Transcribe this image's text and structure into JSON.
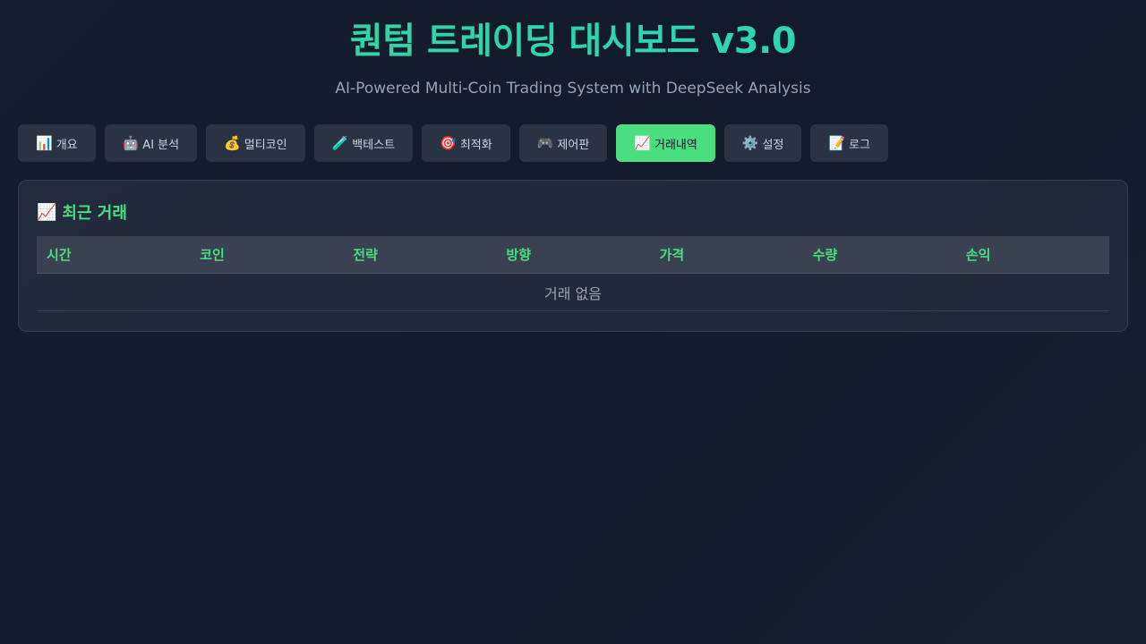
{
  "header": {
    "title": "퀀텀 트레이딩 대시보드 v3.0",
    "subtitle": "AI-Powered Multi-Coin Trading System with DeepSeek Analysis"
  },
  "tabs": [
    {
      "icon": "📊",
      "icon_name": "bar-chart-icon",
      "label": "개요",
      "active": false
    },
    {
      "icon": "🤖",
      "icon_name": "robot-icon",
      "label": "AI 분석",
      "active": false
    },
    {
      "icon": "💰",
      "icon_name": "money-bag-icon",
      "label": "멀티코인",
      "active": false
    },
    {
      "icon": "🧪",
      "icon_name": "test-tube-icon",
      "label": "백테스트",
      "active": false
    },
    {
      "icon": "🎯",
      "icon_name": "target-icon",
      "label": "최적화",
      "active": false
    },
    {
      "icon": "🎮",
      "icon_name": "gamepad-icon",
      "label": "제어판",
      "active": false
    },
    {
      "icon": "📈",
      "icon_name": "chart-up-icon",
      "label": "거래내역",
      "active": true
    },
    {
      "icon": "⚙️",
      "icon_name": "gear-icon",
      "label": "설정",
      "active": false
    },
    {
      "icon": "📝",
      "icon_name": "memo-icon",
      "label": "로그",
      "active": false
    }
  ],
  "panel": {
    "icon": "📈",
    "title": "최근 거래",
    "columns": [
      "시간",
      "코인",
      "전략",
      "방향",
      "가격",
      "수량",
      "손익"
    ],
    "empty_text": "거래 없음"
  },
  "colors": {
    "accent": "#4ade80",
    "title": "#2dd4bf",
    "tab_bg": "#2a3344",
    "background": "#131b2c"
  }
}
